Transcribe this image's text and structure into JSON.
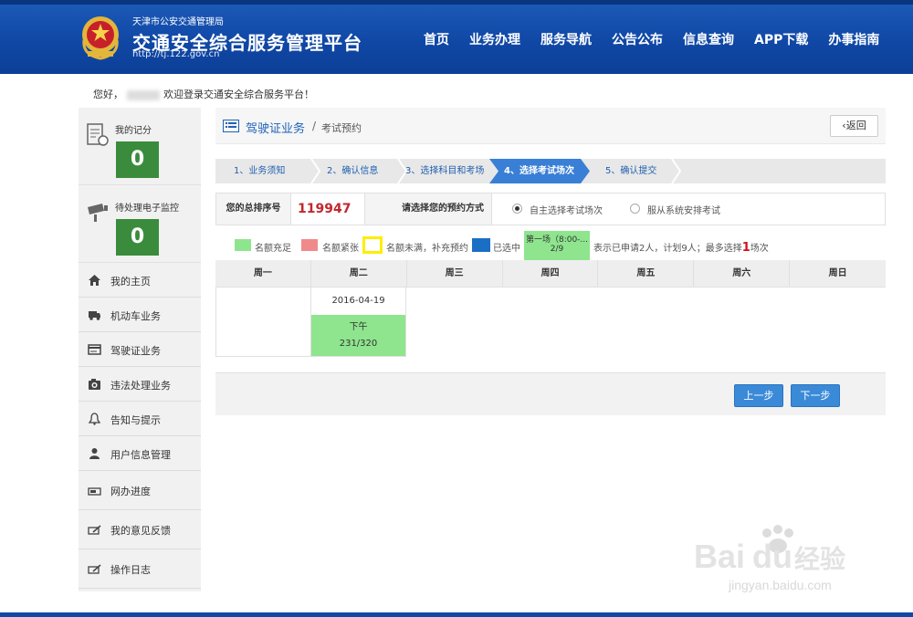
{
  "header": {
    "org": "天津市公安交通管理局",
    "title": "交通安全综合服务管理平台",
    "url": "http://tj.122.gov.cn",
    "nav": [
      "首页",
      "业务办理",
      "服务导航",
      "公告公布",
      "信息查询",
      "APP下载",
      "办事指南"
    ]
  },
  "welcome": {
    "prefix": "您好，",
    "suffix": "欢迎登录交通安全综合服务平台！"
  },
  "sidebar": {
    "score_label": "我的记分",
    "score_value": "0",
    "monitor_label": "待处理电子监控",
    "monitor_value": "0",
    "items": [
      {
        "label": "我的主页",
        "icon": "home-icon"
      },
      {
        "label": "机动车业务",
        "icon": "truck-icon"
      },
      {
        "label": "驾驶证业务",
        "icon": "card-icon"
      },
      {
        "label": "违法处理业务",
        "icon": "camera-icon"
      },
      {
        "label": "告知与提示",
        "icon": "bell-icon"
      },
      {
        "label": "用户信息管理",
        "icon": "user-icon"
      },
      {
        "label": "网办进度",
        "icon": "progress-icon"
      },
      {
        "label": "我的意见反馈",
        "icon": "feedback-icon"
      },
      {
        "label": "操作日志",
        "icon": "log-icon"
      }
    ]
  },
  "breadcrumb": {
    "section": "驾驶证业务",
    "sep": "/",
    "page": "考试预约",
    "back": "返回"
  },
  "steps": [
    {
      "label": "1、业务须知",
      "active": false
    },
    {
      "label": "2、确认信息",
      "active": false
    },
    {
      "label": "3、选择科目和考场",
      "active": false
    },
    {
      "label": "4、选择考试场次",
      "active": true
    },
    {
      "label": "5、确认提交",
      "active": false
    }
  ],
  "info": {
    "rank_label": "您的总排序号",
    "rank_value": "119947",
    "mode_label": "请选择您的预约方式",
    "option1": "自主选择考试场次",
    "option2": "服从系统安排考试"
  },
  "legend": {
    "sufficient": "名额充足",
    "tight": "名额紧张",
    "unfilled": "名额未满，补充预约",
    "selected": "已选中",
    "sample_line1": "第一场（8:00-...",
    "sample_line2": "2/9",
    "note_prefix": "表示已申请2人，计划9人；最多选择",
    "note_num": "1",
    "note_suffix": "场次",
    "colors": {
      "sufficient": "#8ee58e",
      "tight": "#f08a8a",
      "unfilled": "#ffee00",
      "selected": "#1a6fc4"
    }
  },
  "calendar": {
    "headers": [
      "周一",
      "周二",
      "周三",
      "周四",
      "周五",
      "周六",
      "周日"
    ],
    "date": "2016-04-19",
    "slot_name": "下午",
    "slot_count": "231/320"
  },
  "buttons": {
    "prev": "上一步",
    "next": "下一步"
  }
}
